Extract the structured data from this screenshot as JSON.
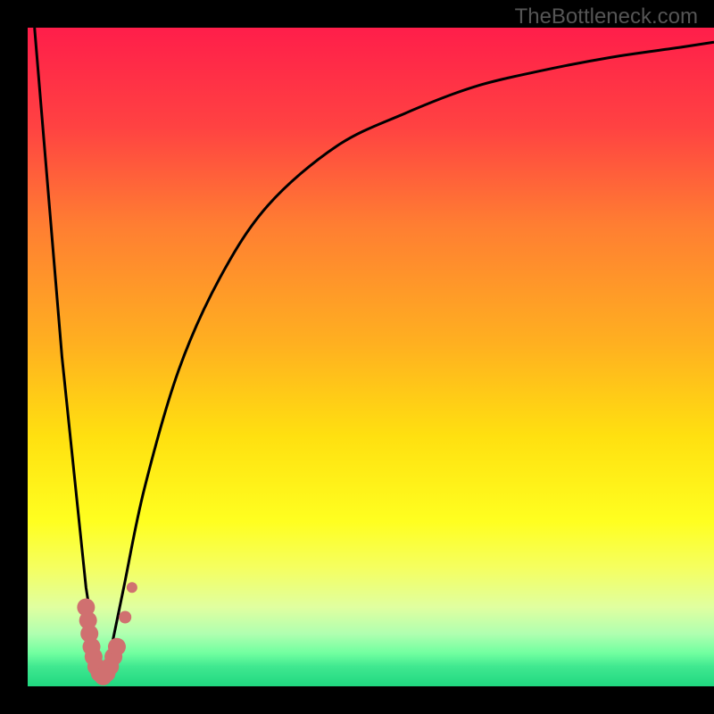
{
  "watermark": "TheBottleneck.com",
  "chart_data": {
    "type": "line",
    "title": "",
    "xlabel": "",
    "ylabel": "",
    "xlim": [
      0,
      100
    ],
    "ylim": [
      0,
      100
    ],
    "background_gradient": {
      "stops": [
        {
          "offset": 0,
          "color": "#ff1e4a"
        },
        {
          "offset": 15,
          "color": "#ff4242"
        },
        {
          "offset": 30,
          "color": "#ff7e32"
        },
        {
          "offset": 48,
          "color": "#ffb020"
        },
        {
          "offset": 62,
          "color": "#ffe010"
        },
        {
          "offset": 75,
          "color": "#ffff20"
        },
        {
          "offset": 82,
          "color": "#f5ff60"
        },
        {
          "offset": 88,
          "color": "#e0ffa0"
        },
        {
          "offset": 92,
          "color": "#b0ffb0"
        },
        {
          "offset": 95,
          "color": "#70ffa0"
        },
        {
          "offset": 97,
          "color": "#40e890"
        },
        {
          "offset": 100,
          "color": "#20d880"
        }
      ]
    },
    "series": [
      {
        "name": "left-curve",
        "type": "line",
        "points": [
          {
            "x": 1,
            "y": 100
          },
          {
            "x": 3,
            "y": 75
          },
          {
            "x": 5,
            "y": 50
          },
          {
            "x": 7,
            "y": 30
          },
          {
            "x": 8.5,
            "y": 15
          },
          {
            "x": 10,
            "y": 5
          },
          {
            "x": 11,
            "y": 1
          }
        ]
      },
      {
        "name": "right-curve",
        "type": "line",
        "points": [
          {
            "x": 11,
            "y": 1
          },
          {
            "x": 12,
            "y": 5
          },
          {
            "x": 14,
            "y": 15
          },
          {
            "x": 17,
            "y": 30
          },
          {
            "x": 22,
            "y": 48
          },
          {
            "x": 28,
            "y": 62
          },
          {
            "x": 35,
            "y": 73
          },
          {
            "x": 45,
            "y": 82
          },
          {
            "x": 55,
            "y": 87
          },
          {
            "x": 65,
            "y": 91
          },
          {
            "x": 75,
            "y": 93.5
          },
          {
            "x": 85,
            "y": 95.5
          },
          {
            "x": 95,
            "y": 97
          },
          {
            "x": 100,
            "y": 97.8
          }
        ]
      }
    ],
    "scatter_points": {
      "name": "data-markers",
      "color": "#d07070",
      "points": [
        {
          "x": 8.5,
          "y": 12,
          "r": 10
        },
        {
          "x": 8.8,
          "y": 10,
          "r": 10
        },
        {
          "x": 9,
          "y": 8,
          "r": 10
        },
        {
          "x": 9.3,
          "y": 6,
          "r": 10
        },
        {
          "x": 9.6,
          "y": 4.5,
          "r": 10
        },
        {
          "x": 10,
          "y": 3,
          "r": 10
        },
        {
          "x": 10.5,
          "y": 2,
          "r": 10
        },
        {
          "x": 11,
          "y": 1.5,
          "r": 10
        },
        {
          "x": 11.5,
          "y": 2,
          "r": 10
        },
        {
          "x": 12,
          "y": 3,
          "r": 10
        },
        {
          "x": 12.5,
          "y": 4.5,
          "r": 10
        },
        {
          "x": 13,
          "y": 6,
          "r": 10
        },
        {
          "x": 14.2,
          "y": 10.5,
          "r": 7
        },
        {
          "x": 15.2,
          "y": 15,
          "r": 6
        }
      ]
    }
  }
}
